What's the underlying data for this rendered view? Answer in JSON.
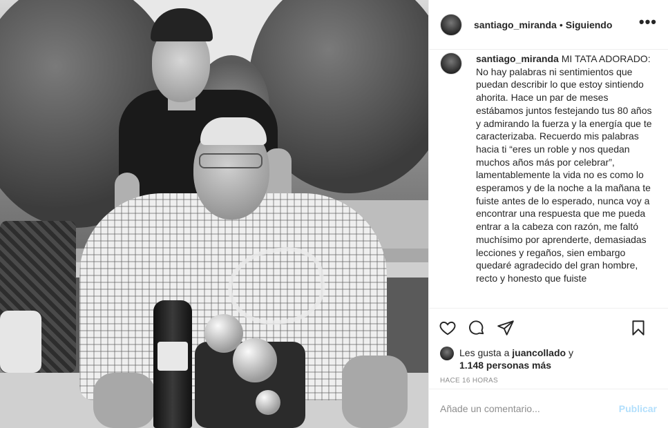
{
  "header": {
    "username": "santiago_miranda",
    "separator": "•",
    "follow_status": "Siguiendo",
    "more_label": "•••"
  },
  "caption": {
    "username": "santiago_miranda",
    "text": "MI TATA ADORADO: No hay palabras ni sentimientos que puedan describir lo que estoy sintiendo ahorita. Hace un par de meses estábamos juntos festejando tus 80 años y admirando la fuerza y la energía que te caracterizaba. Recuerdo mis palabras hacia ti “eres un roble y nos quedan muchos años más por celebrar”, lamentablemente la vida no es como lo esperamos y de la noche a la mañana te fuiste antes de lo esperado, nunca voy a encontrar una respuesta que me pueda entrar a la cabeza con razón, me faltó muchísimo por aprenderte, demasiadas lecciones y regaños, sien embargo quedaré agradecido del gran hombre, recto y honesto que fuiste"
  },
  "actions": {
    "icons": [
      "heart-icon",
      "comment-icon",
      "share-icon",
      "bookmark-icon"
    ]
  },
  "likes": {
    "prefix": "Les gusta a",
    "liker": "juancollado",
    "connector": "y",
    "others": "1.148 personas más"
  },
  "timestamp": "HACE 16 HORAS",
  "comment": {
    "placeholder": "Añade un comentario...",
    "publish_label": "Publicar"
  },
  "colors": {
    "publish_disabled": "#b2dffc",
    "muted_text": "#8e8e8e",
    "divider": "#efefef"
  }
}
